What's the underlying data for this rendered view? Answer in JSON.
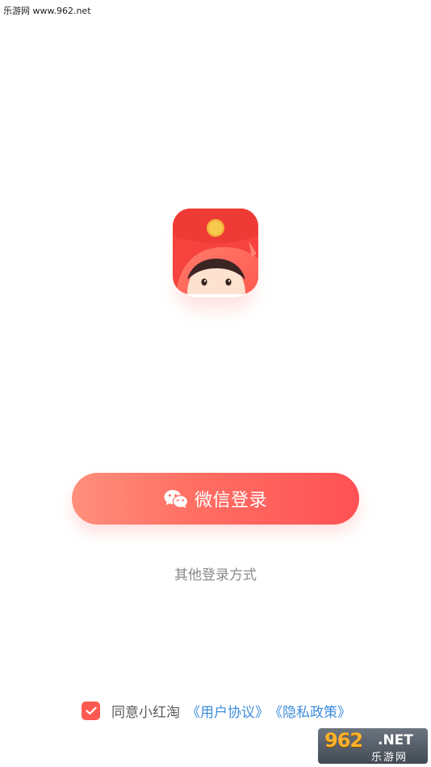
{
  "watermark": {
    "top_text": "乐游网 www.962.net",
    "badge_top": "962",
    "badge_net": ".NET",
    "badge_bottom": "乐游网"
  },
  "logo": {
    "icon": "red-envelope-girl-logo",
    "colors": {
      "envelope": "#f7453f",
      "coin": "#f8c94c",
      "hood": "#ff7161",
      "face": "#fde3cf"
    }
  },
  "login": {
    "wechat_label": "微信登录",
    "wechat_icon": "wechat-icon",
    "other_methods": "其他登录方式"
  },
  "agreement": {
    "checked": true,
    "text": "同意小红淘",
    "user_agreement": "《用户协议》",
    "privacy_policy": "《隐私政策》"
  },
  "colors": {
    "accent": "#ff5a52",
    "link": "#3c8ddc",
    "muted_text": "#8a8a8a"
  }
}
